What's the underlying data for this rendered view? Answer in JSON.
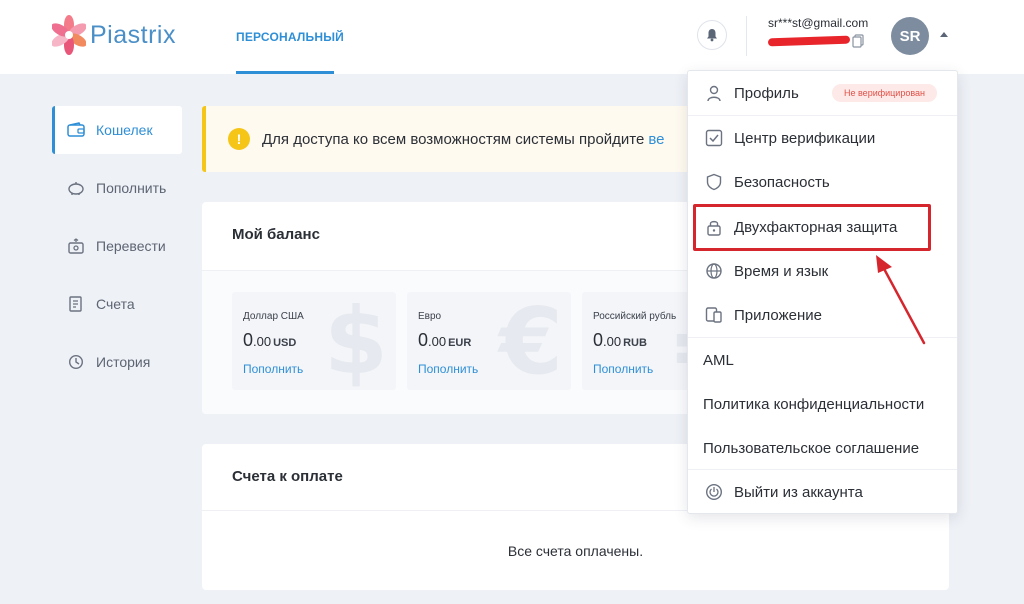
{
  "header": {
    "brand": "Piastrix",
    "nav_tab": "ПЕРСОНАЛЬНЫЙ",
    "email": "sr***st@gmail.com",
    "avatar_initials": "SR"
  },
  "sidebar": {
    "items": [
      {
        "label": "Кошелек",
        "icon": "wallet-icon",
        "active": true
      },
      {
        "label": "Пополнить",
        "icon": "piggy-bank-icon",
        "active": false
      },
      {
        "label": "Перевести",
        "icon": "transfer-icon",
        "active": false
      },
      {
        "label": "Счета",
        "icon": "invoice-icon",
        "active": false
      },
      {
        "label": "История",
        "icon": "history-icon",
        "active": false
      }
    ]
  },
  "alert": {
    "text": "Для доступа ко всем возможностям системы пройдите",
    "link": "ве"
  },
  "balance": {
    "title": "Мой баланс",
    "currencies": [
      {
        "name": "Доллар США",
        "amount_int": "0",
        "amount_dec": ".00",
        "code": "USD",
        "action": "Пополнить",
        "symbol": "$"
      },
      {
        "name": "Евро",
        "amount_int": "0",
        "amount_dec": ".00",
        "code": "EUR",
        "action": "Пополнить",
        "symbol": "€"
      },
      {
        "name": "Российский рубль",
        "amount_int": "0",
        "amount_dec": ".00",
        "code": "RUB",
        "action": "Пополнить",
        "symbol": "₽"
      }
    ]
  },
  "invoices": {
    "title": "Счета к оплате",
    "empty_text": "Все счета оплачены."
  },
  "dropdown": {
    "profile": "Профиль",
    "profile_badge": "Не верифицирован",
    "verification": "Центр верификации",
    "security": "Безопасность",
    "two_factor": "Двухфакторная защита",
    "time_language": "Время и язык",
    "app": "Приложение",
    "aml": "AML",
    "privacy": "Политика конфиденциальности",
    "agreement": "Пользовательское соглашение",
    "logout": "Выйти из аккаунта"
  },
  "colors": {
    "accent": "#2f8fd6",
    "highlight": "#d6262d",
    "warning": "#f5c518"
  }
}
